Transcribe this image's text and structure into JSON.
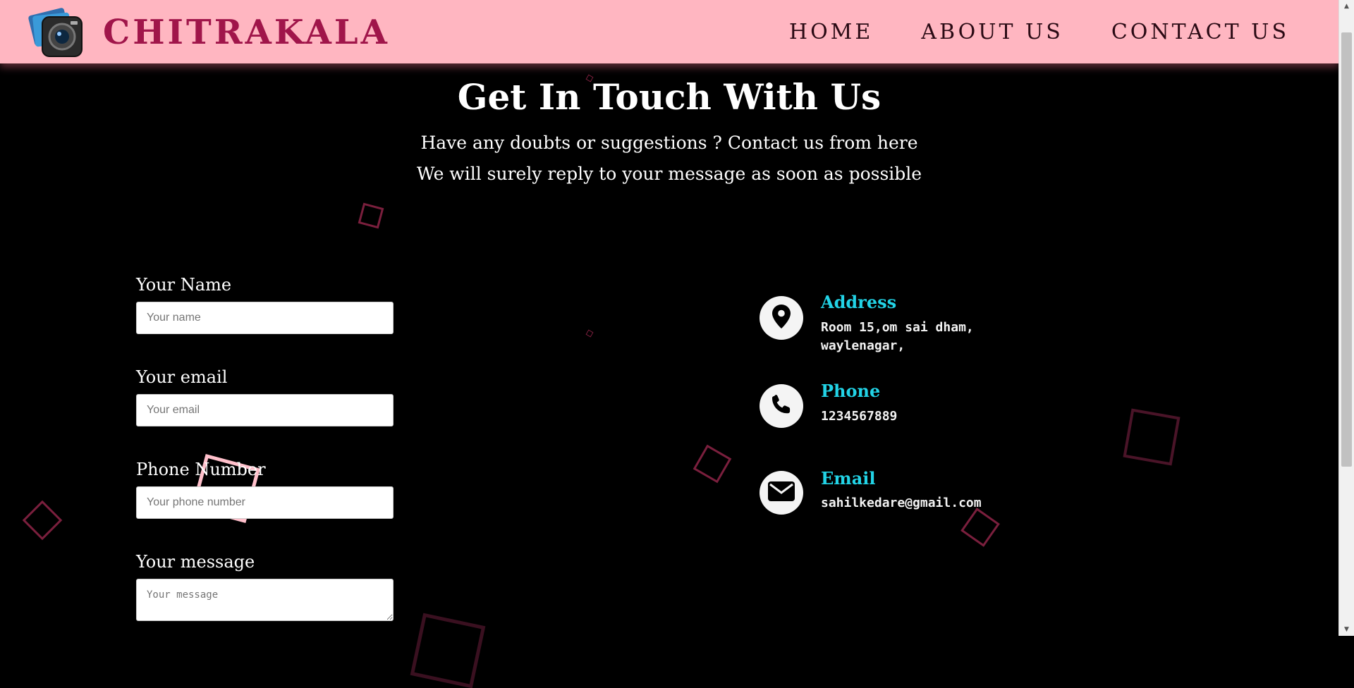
{
  "header": {
    "brand": "CHITRAKALA",
    "nav": [
      {
        "label": "HOME"
      },
      {
        "label": "ABOUT US"
      },
      {
        "label": "CONTACT US"
      }
    ]
  },
  "hero": {
    "title": "Get In Touch With Us",
    "line1": "Have any doubts or suggestions ? Contact us from here",
    "line2": "We will surely reply to your message as soon as possible"
  },
  "form": {
    "name": {
      "label": "Your Name",
      "placeholder": "Your name"
    },
    "email": {
      "label": "Your email",
      "placeholder": "Your email"
    },
    "phone": {
      "label": "Phone Number",
      "placeholder": "Your phone number"
    },
    "message": {
      "label": "Your message",
      "placeholder": "Your message"
    }
  },
  "contact": {
    "address": {
      "heading": "Address",
      "line1": "Room 15,om sai dham,",
      "line2": "waylenagar,",
      "icon": "map-pin-icon"
    },
    "phone": {
      "heading": "Phone",
      "value": "1234567889",
      "icon": "phone-icon"
    },
    "email": {
      "heading": "Email",
      "value": "sahilkedare@gmail.com",
      "icon": "envelope-icon"
    }
  },
  "colors": {
    "header_bg": "#ffb6c1",
    "brand": "#a0154a",
    "accent": "#22d3e6",
    "square": "#7a1f3d"
  }
}
